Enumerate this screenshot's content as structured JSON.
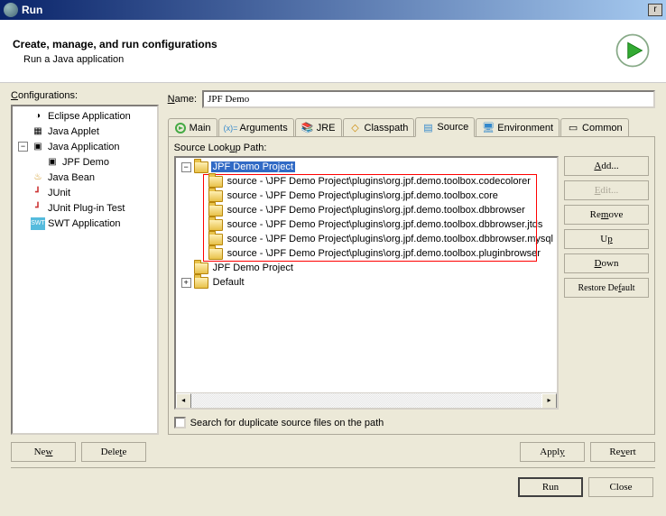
{
  "titlebar": {
    "title": "Run",
    "close": "r"
  },
  "header": {
    "title": "Create, manage, and run configurations",
    "subtitle": "Run a Java application"
  },
  "configurations": {
    "label": "Configurations:",
    "items": [
      {
        "label": "Eclipse Application",
        "icon": "eclipse"
      },
      {
        "label": "Java Applet",
        "icon": "applet"
      },
      {
        "label": "Java Application",
        "icon": "java-app",
        "expanded": true,
        "children": [
          {
            "label": "JPF Demo",
            "icon": "java-app"
          }
        ]
      },
      {
        "label": "Java Bean",
        "icon": "bean"
      },
      {
        "label": "JUnit",
        "icon": "junit"
      },
      {
        "label": "JUnit Plug-in Test",
        "icon": "junit-plugin"
      },
      {
        "label": "SWT Application",
        "icon": "swt"
      }
    ],
    "buttons": {
      "new": "New",
      "delete": "Delete"
    }
  },
  "detail": {
    "name_label": "Name:",
    "name_value": "JPF Demo",
    "tabs": [
      {
        "label": "Main",
        "icon": "main"
      },
      {
        "label": "Arguments",
        "icon": "args"
      },
      {
        "label": "JRE",
        "icon": "jre"
      },
      {
        "label": "Classpath",
        "icon": "classpath"
      },
      {
        "label": "Source",
        "icon": "source",
        "active": true
      },
      {
        "label": "Environment",
        "icon": "env"
      },
      {
        "label": "Common",
        "icon": "common"
      }
    ],
    "lookup_label": "Source Lookup Path:",
    "lookup_tree": [
      {
        "label": "JPF Demo Project",
        "expanded": true,
        "selected": true,
        "children": [
          {
            "label": "source - \\JPF Demo Project\\plugins\\org.jpf.demo.toolbox.codecolorer"
          },
          {
            "label": "source - \\JPF Demo Project\\plugins\\org.jpf.demo.toolbox.core"
          },
          {
            "label": "source - \\JPF Demo Project\\plugins\\org.jpf.demo.toolbox.dbbrowser"
          },
          {
            "label": "source - \\JPF Demo Project\\plugins\\org.jpf.demo.toolbox.dbbrowser.jtds"
          },
          {
            "label": "source - \\JPF Demo Project\\plugins\\org.jpf.demo.toolbox.dbbrowser.mysql"
          },
          {
            "label": "source - \\JPF Demo Project\\plugins\\org.jpf.demo.toolbox.pluginbrowser"
          }
        ]
      },
      {
        "label": "JPF Demo Project",
        "expanded": false
      },
      {
        "label": "Default",
        "expanded": false
      }
    ],
    "lookup_buttons": {
      "add": "Add...",
      "edit": "Edit...",
      "remove": "Remove",
      "up": "Up",
      "down": "Down",
      "restore": "Restore Default"
    },
    "search_dup": "Search for duplicate source files on the path",
    "bottom_buttons": {
      "apply": "Apply",
      "revert": "Revert"
    }
  },
  "dialog_buttons": {
    "run": "Run",
    "close": "Close"
  }
}
